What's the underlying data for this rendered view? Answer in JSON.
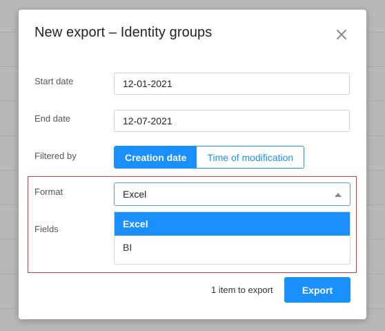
{
  "modal": {
    "title": "New export – Identity groups"
  },
  "form": {
    "start_date": {
      "label": "Start date",
      "value": "12-01-2021"
    },
    "end_date": {
      "label": "End date",
      "value": "12-07-2021"
    },
    "filtered_by": {
      "label": "Filtered by",
      "options": [
        "Creation date",
        "Time of modification"
      ],
      "selected": "Creation date"
    },
    "format": {
      "label": "Format",
      "value": "Excel",
      "options": [
        "Excel",
        "BI"
      ]
    },
    "fields": {
      "label": "Fields"
    }
  },
  "footer": {
    "count_text": "1 item to export",
    "export_label": "Export"
  },
  "colors": {
    "accent": "#1a90ff",
    "highlight_border": "#d9363e",
    "overlay": "#b8b8b8"
  },
  "icons": {
    "close": "close-icon",
    "caret": "caret-up-icon"
  }
}
